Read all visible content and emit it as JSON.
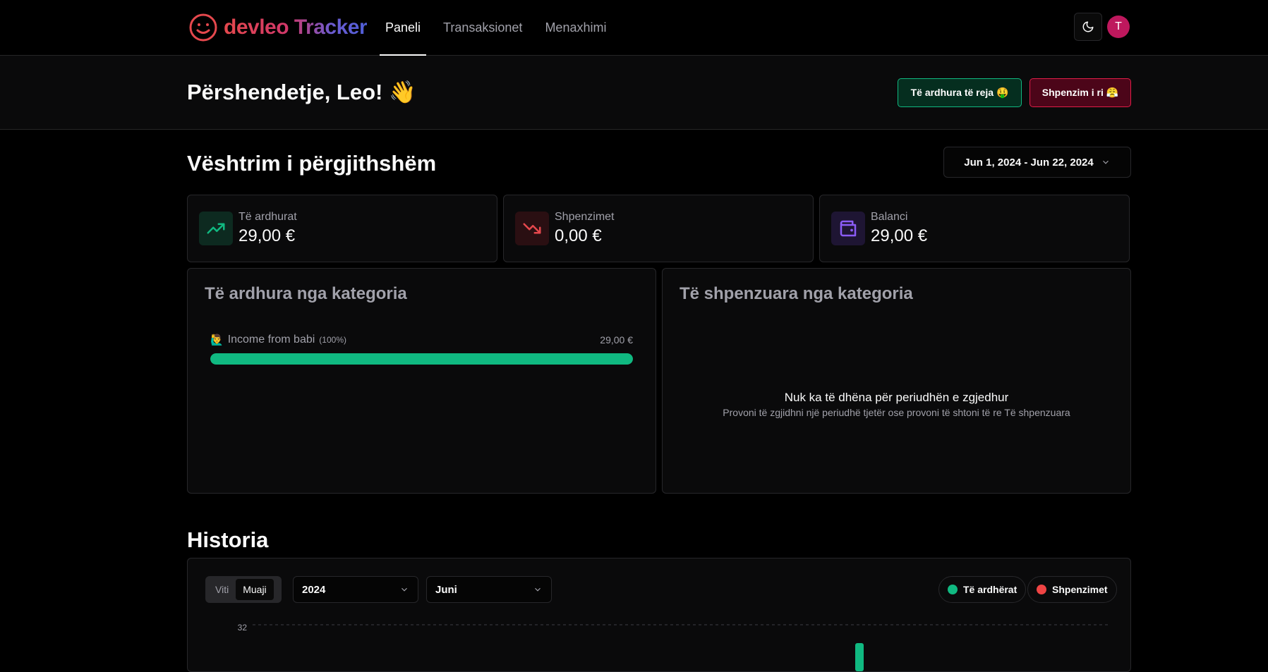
{
  "app": {
    "logo_text": "devleo Tracker",
    "nav": [
      {
        "label": "Paneli",
        "active": true
      },
      {
        "label": "Transaksionet"
      },
      {
        "label": "Menaxhimi"
      }
    ],
    "avatar_initial": "T"
  },
  "greeting": {
    "text": "Përshendetje, Leo! 👋",
    "new_income_label": "Të ardhura të reja 🤑",
    "new_expense_label": "Shpenzim i ri 😤"
  },
  "overview": {
    "title": "Vështrim i përgjithshëm",
    "date_range": "Jun 1, 2024 - Jun 22, 2024",
    "stats": [
      {
        "label": "Të ardhurat",
        "value": "29,00 €",
        "icon": "trending-up-icon",
        "color": "#10b981"
      },
      {
        "label": "Shpenzimet",
        "value": "0,00 €",
        "icon": "trending-down-icon",
        "color": "#e5484d"
      },
      {
        "label": "Balanci",
        "value": "29,00 €",
        "icon": "wallet-icon",
        "color": "#8b5cf6"
      }
    ]
  },
  "income_by_category": {
    "title": "Të ardhura nga kategoria",
    "items": [
      {
        "emoji": "🙋‍♂️",
        "name": "Income from babi",
        "percent_label": "(100%)",
        "amount": "29,00 €",
        "percent": 100
      }
    ]
  },
  "expense_by_category": {
    "title": "Të shpenzuara nga kategoria",
    "empty_title": "Nuk ka të dhëna për periudhën e zgjedhur",
    "empty_subtitle": "Provoni të zgjidhni një periudhë tjetër ose provoni të shtoni të re Të shpenzuara"
  },
  "history": {
    "title": "Historia",
    "toggle": [
      {
        "label": "Viti"
      },
      {
        "label": "Muaji",
        "active": true
      }
    ],
    "year_select": "2024",
    "month_select": "Juni",
    "legend": [
      {
        "label": "Të ardhërat",
        "color": "#10b981"
      },
      {
        "label": "Shpenzimet",
        "color": "#ef4444"
      }
    ]
  },
  "chart_data": {
    "type": "bar",
    "y_tick_labels": [
      "32"
    ],
    "ylim": [
      0,
      32
    ],
    "series": [
      {
        "name": "Të ardhërat",
        "color": "#10b981"
      },
      {
        "name": "Shpenzimet",
        "color": "#ef4444"
      }
    ]
  }
}
